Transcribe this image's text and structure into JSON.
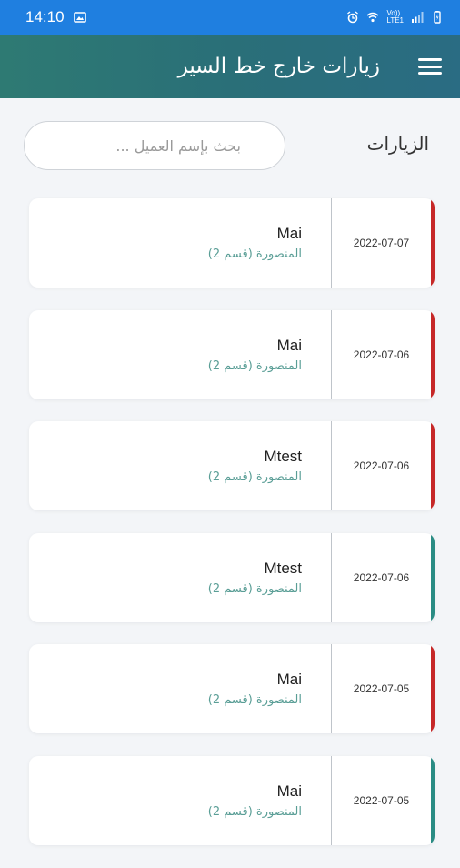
{
  "status_bar": {
    "time": "14:10",
    "network_label": "Vo))\nLTE1",
    "icons": [
      "image-icon",
      "alarm-icon",
      "wifi-icon",
      "signal-icon",
      "battery-icon"
    ]
  },
  "app_bar": {
    "title": "زيارات خارج خط السير",
    "menu_icon": "hamburger-menu-icon"
  },
  "section": {
    "label": "الزيارات"
  },
  "search": {
    "placeholder": "بحث بإسم العميل ...",
    "value": ""
  },
  "colors": {
    "status_bar": "#1f7fe0",
    "app_bar": "#2a6f78",
    "strip_red": "#c62828",
    "strip_teal": "#2a8c84",
    "location_text": "#5a9e96"
  },
  "visits": [
    {
      "date": "2022-07-07",
      "name": "Mai",
      "location": "المنصورة (قسم 2)",
      "strip": "#c62828"
    },
    {
      "date": "2022-07-06",
      "name": "Mai",
      "location": "المنصورة (قسم 2)",
      "strip": "#c62828"
    },
    {
      "date": "2022-07-06",
      "name": "Mtest",
      "location": "المنصورة (قسم 2)",
      "strip": "#c62828"
    },
    {
      "date": "2022-07-06",
      "name": "Mtest",
      "location": "المنصورة (قسم 2)",
      "strip": "#2a8c84"
    },
    {
      "date": "2022-07-05",
      "name": "Mai",
      "location": "المنصورة (قسم 2)",
      "strip": "#c62828"
    },
    {
      "date": "2022-07-05",
      "name": "Mai",
      "location": "المنصورة (قسم 2)",
      "strip": "#2a8c84"
    }
  ]
}
